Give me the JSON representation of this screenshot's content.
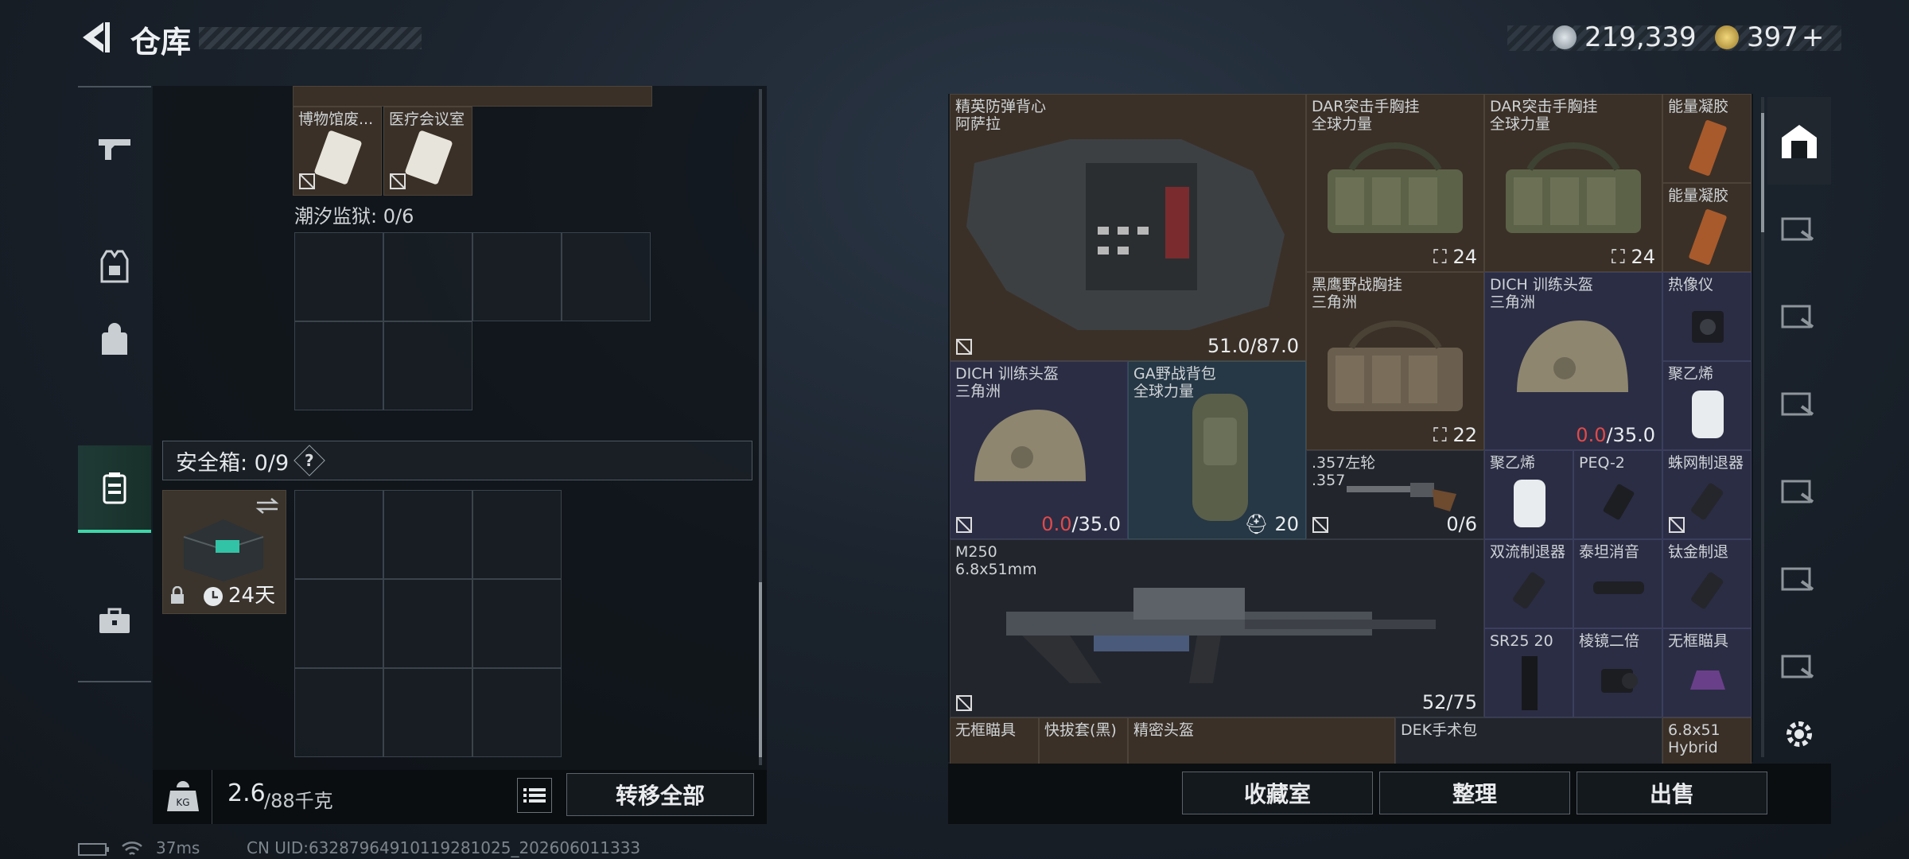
{
  "header": {
    "title": "仓库"
  },
  "currency": [
    {
      "value": "219,339",
      "color": "#b9c4cc"
    },
    {
      "value": "397",
      "color": "#d8b24a",
      "plus": "+"
    }
  ],
  "left": {
    "region_label": "潮汐监狱: 0/6",
    "top_items": [
      {
        "name": "博物馆废..."
      },
      {
        "name": "医疗会议室"
      }
    ],
    "safebox": {
      "label": "安全箱: 0/9",
      "help": "?",
      "timer": "24天"
    },
    "weight": {
      "current": "2.6",
      "max": "/88千克"
    },
    "transfer_all": "转移全部"
  },
  "stash": {
    "items": [
      {
        "name": "精英防弹背心\n阿萨拉",
        "value": "51.0/87.0"
      },
      {
        "name": "DAR突击手胸挂\n全球力量",
        "value": "24"
      },
      {
        "name": "DAR突击手胸挂\n全球力量",
        "value": "24"
      },
      {
        "name": "能量凝胶"
      },
      {
        "name": "能量凝胶"
      },
      {
        "name": "黑鹰野战胸挂\n三角洲",
        "value": "22"
      },
      {
        "name": "DICH 训练头盔\n三角洲",
        "value_red": "0.0",
        "value_rest": "/35.0"
      },
      {
        "name": "热像仪"
      },
      {
        "name": "聚乙烯"
      },
      {
        "name": "DICH 训练头盔\n三角洲",
        "value_red": "0.0",
        "value_rest": "/35.0"
      },
      {
        "name": "GA野战背包\n全球力量",
        "value": "20"
      },
      {
        "name": ".357左轮\n.357",
        "value": "0/6"
      },
      {
        "name": "聚乙烯"
      },
      {
        "name": "PEQ-2"
      },
      {
        "name": "蛛网制退器"
      },
      {
        "name": "M250\n6.8x51mm",
        "value": "52/75"
      },
      {
        "name": "双流制退器"
      },
      {
        "name": "泰坦消音"
      },
      {
        "name": "钛金制退"
      },
      {
        "name": "SR25 20"
      },
      {
        "name": "棱镜二倍"
      },
      {
        "name": "无框瞄具"
      },
      {
        "name": "无框瞄具"
      },
      {
        "name": "快拔套(黑)"
      },
      {
        "name": "精密头盔"
      },
      {
        "name": "DEK手术包"
      },
      {
        "name": "6.8x51\nHybrid"
      }
    ],
    "buttons": {
      "collection": "收藏室",
      "sort": "整理",
      "sell": "出售"
    }
  },
  "status": {
    "ping": "37ms",
    "uid": "CN UID:6328796491011928102​5_202606011333"
  }
}
